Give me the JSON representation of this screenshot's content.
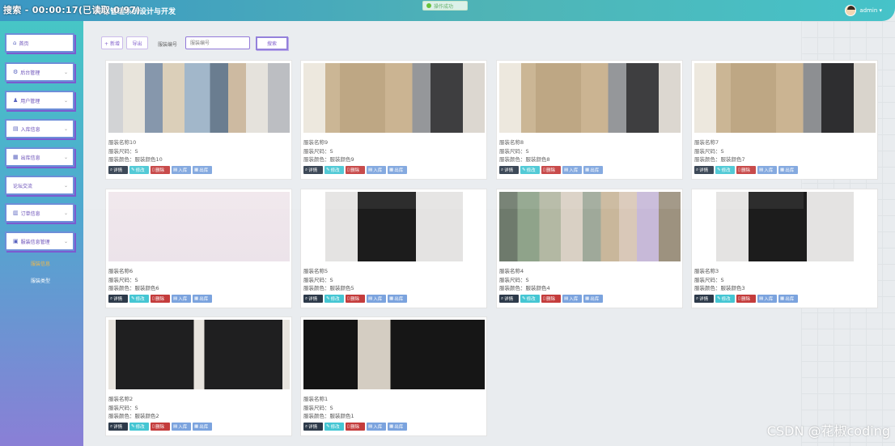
{
  "header": {
    "title_partial": "库存管理系统设计与开发",
    "rec_overlay": "搜索 - 00:00:17(已读取 0/97)",
    "toast": "操作成功",
    "user": "admin ▾"
  },
  "sidebar": {
    "items": [
      {
        "label": "首页",
        "icon": "home-icon",
        "has_chevron": false
      },
      {
        "label": "后台管理",
        "icon": "gear-icon",
        "has_chevron": true
      },
      {
        "label": "用户管理",
        "icon": "user-icon",
        "has_chevron": true
      },
      {
        "label": "入库信息",
        "icon": "inbox-icon",
        "has_chevron": true
      },
      {
        "label": "出库信息",
        "icon": "outbox-icon",
        "has_chevron": true
      },
      {
        "label": "论坛交流",
        "icon": "",
        "has_chevron": true
      },
      {
        "label": "订单信息",
        "icon": "order-icon",
        "has_chevron": true
      },
      {
        "label": "服装信息管理",
        "icon": "clothes-icon",
        "has_chevron": true
      }
    ],
    "sub_items": [
      {
        "label": "服装信息",
        "active": true
      },
      {
        "label": "服装类型",
        "active": false
      }
    ]
  },
  "toolbar": {
    "add_label": "+ 新增",
    "export_label": "导出",
    "search_label": "服装编号",
    "search_placeholder": "服装编号",
    "search_button": "搜索"
  },
  "card_labels": {
    "name": "服装名称",
    "size": "服装尺码：",
    "color": "服装颜色：",
    "detail": "详情",
    "edit": "修改",
    "delete": "删除",
    "stock_in": "入库",
    "stock_out": "出库"
  },
  "cards": [
    {
      "name": "服装名称10",
      "size": "S",
      "color": "服装颜色10",
      "photo": "rack"
    },
    {
      "name": "服装名称9",
      "size": "S",
      "color": "服装颜色9",
      "photo": "beige"
    },
    {
      "name": "服装名称8",
      "size": "S",
      "color": "服装颜色8",
      "photo": "beige"
    },
    {
      "name": "服装名称7",
      "size": "S",
      "color": "服装颜色7",
      "photo": "beige"
    },
    {
      "name": "服装名称6",
      "size": "S",
      "color": "服装颜色6",
      "photo": "white"
    },
    {
      "name": "服装名称5",
      "size": "S",
      "color": "服装颜色5",
      "photo": "black"
    },
    {
      "name": "服装名称4",
      "size": "S",
      "color": "服装颜色4",
      "photo": "floral"
    },
    {
      "name": "服装名称3",
      "size": "S",
      "color": "服装颜色3",
      "photo": "black"
    },
    {
      "name": "服装名称2",
      "size": "S",
      "color": "服装颜色2",
      "photo": "men"
    },
    {
      "name": "服装名称1",
      "size": "S",
      "color": "服装颜色1",
      "photo": "runway"
    }
  ],
  "watermark": "CSDN @花椒coding",
  "colors": {
    "header_start": "#3b97c4",
    "header_end": "#46c3c9",
    "sidebar_top": "#47c6c6",
    "sidebar_bottom": "#8a7fd6",
    "accent_purple": "#7a56c9",
    "btn_detail": "#2d3a4a",
    "btn_edit": "#45c6d3",
    "btn_delete": "#c43c3c",
    "btn_stock": "#7ba3de"
  }
}
